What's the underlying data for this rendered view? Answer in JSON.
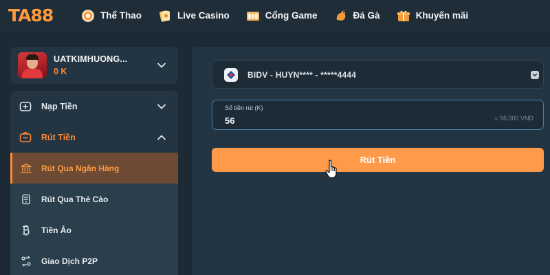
{
  "brand": {
    "logo_ta": "TA",
    "logo_88": "88"
  },
  "nav": {
    "items": [
      {
        "label": "Thể Thao",
        "icon": "sports-ball-icon"
      },
      {
        "label": "Live Casino",
        "icon": "cards-icon"
      },
      {
        "label": "Cổng Game",
        "icon": "slot-machine-icon"
      },
      {
        "label": "Đá Gà",
        "icon": "rooster-icon"
      },
      {
        "label": "Khuyến mãi",
        "icon": "gift-icon"
      }
    ]
  },
  "user": {
    "name": "UATKIMHUONG...",
    "balance": "0 K"
  },
  "sidebar": {
    "deposit": {
      "label": "Nạp Tiền"
    },
    "withdraw": {
      "label": "Rút Tiền"
    },
    "withdraw_items": [
      {
        "label": "Rút Qua Ngân Hàng",
        "active": true
      },
      {
        "label": "Rút Qua Thẻ Cào",
        "active": false
      },
      {
        "label": "Tiền Ảo",
        "active": false
      },
      {
        "label": "Giao Dịch P2P",
        "active": false
      }
    ]
  },
  "form": {
    "bank_account": "BIDV - HUYN**** - *****4444",
    "amount_label": "Số tiền rút (K)",
    "amount_value": "56",
    "amount_converted": "= 56.000 VND",
    "submit_label": "Rút Tiền"
  },
  "colors": {
    "accent": "#ff8a34",
    "button": "#ff9a4a",
    "panel": "#233542",
    "background": "#1b2a35"
  }
}
